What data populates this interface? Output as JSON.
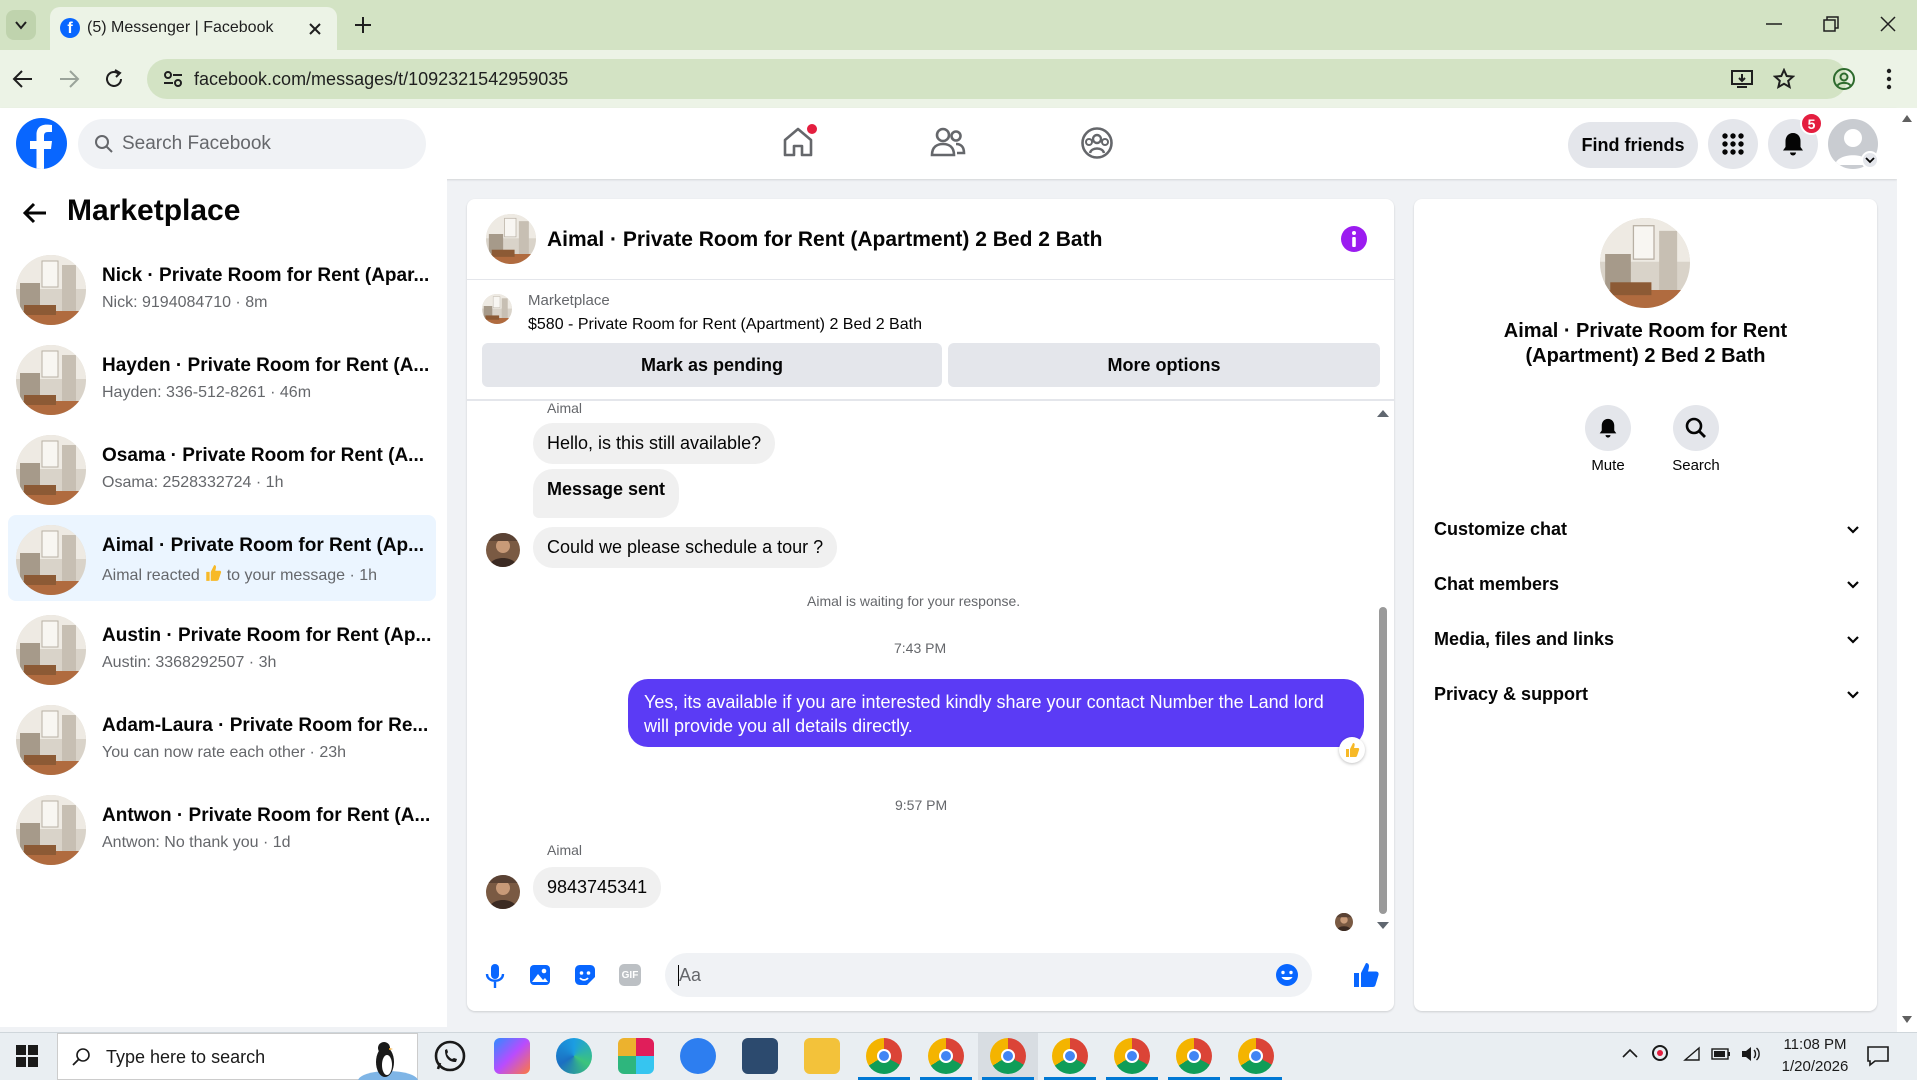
{
  "browser": {
    "tab_title": "(5) Messenger | Facebook",
    "url": "facebook.com/messages/t/1092321542959035"
  },
  "header": {
    "search_placeholder": "Search Facebook",
    "find_friends": "Find friends",
    "notification_count": "5"
  },
  "sidebar": {
    "title": "Marketplace",
    "conversations": [
      {
        "title": "Nick · Private Room for Rent (Apar...",
        "subtitle": "Nick: 9194084710 · 8m"
      },
      {
        "title": "Hayden · Private Room for Rent (A...",
        "subtitle": "Hayden: 336-512-8261 · 46m"
      },
      {
        "title": "Osama · Private Room for Rent (A...",
        "subtitle": "Osama: 2528332724 · 1h"
      },
      {
        "title": "Aimal · Private Room for Rent (Ap...",
        "subtitle_prefix": "Aimal reacted",
        "subtitle_suffix": "to your message · 1h"
      },
      {
        "title": "Austin · Private Room for Rent (Ap...",
        "subtitle": "Austin: 3368292507 · 3h"
      },
      {
        "title": "Adam-Laura · Private Room for Re...",
        "subtitle": "You can now rate each other · 23h"
      },
      {
        "title": "Antwon · Private Room for Rent (A...",
        "subtitle": "Antwon: No thank you · 1d"
      }
    ]
  },
  "chat": {
    "title": "Aimal · Private Room for Rent (Apartment) 2 Bed 2 Bath",
    "listing_source": "Marketplace",
    "listing_title": "$580 - Private Room for Rent (Apartment) 2 Bed 2 Bath",
    "mark_pending": "Mark as pending",
    "more_options": "More options",
    "sender_name": "Aimal",
    "msg1": "Hello, is this still available?",
    "msg2": "Message sent",
    "msg3": "Could we please schedule a tour ?",
    "waiting": "Aimal is waiting for your response.",
    "time1": "7:43 PM",
    "outgoing": "Yes, its available if you are interested kindly share your contact Number the Land lord will provide you all details directly.",
    "time2": "9:57 PM",
    "sender_name2": "Aimal",
    "msg4": "9843745341",
    "input_placeholder": "Aa"
  },
  "info": {
    "name": "Aimal · Private Room for Rent (Apartment) 2 Bed 2 Bath",
    "mute": "Mute",
    "search": "Search",
    "sections": [
      "Customize chat",
      "Chat members",
      "Media, files and links",
      "Privacy & support"
    ]
  },
  "taskbar": {
    "search_placeholder": "Type here to search",
    "time": "11:08 PM",
    "date": "1/20/2026"
  },
  "colors": {
    "fb_blue": "#0866ff",
    "messenger_purple": "#5b3bf5",
    "info_purple": "#9b1cf0"
  }
}
